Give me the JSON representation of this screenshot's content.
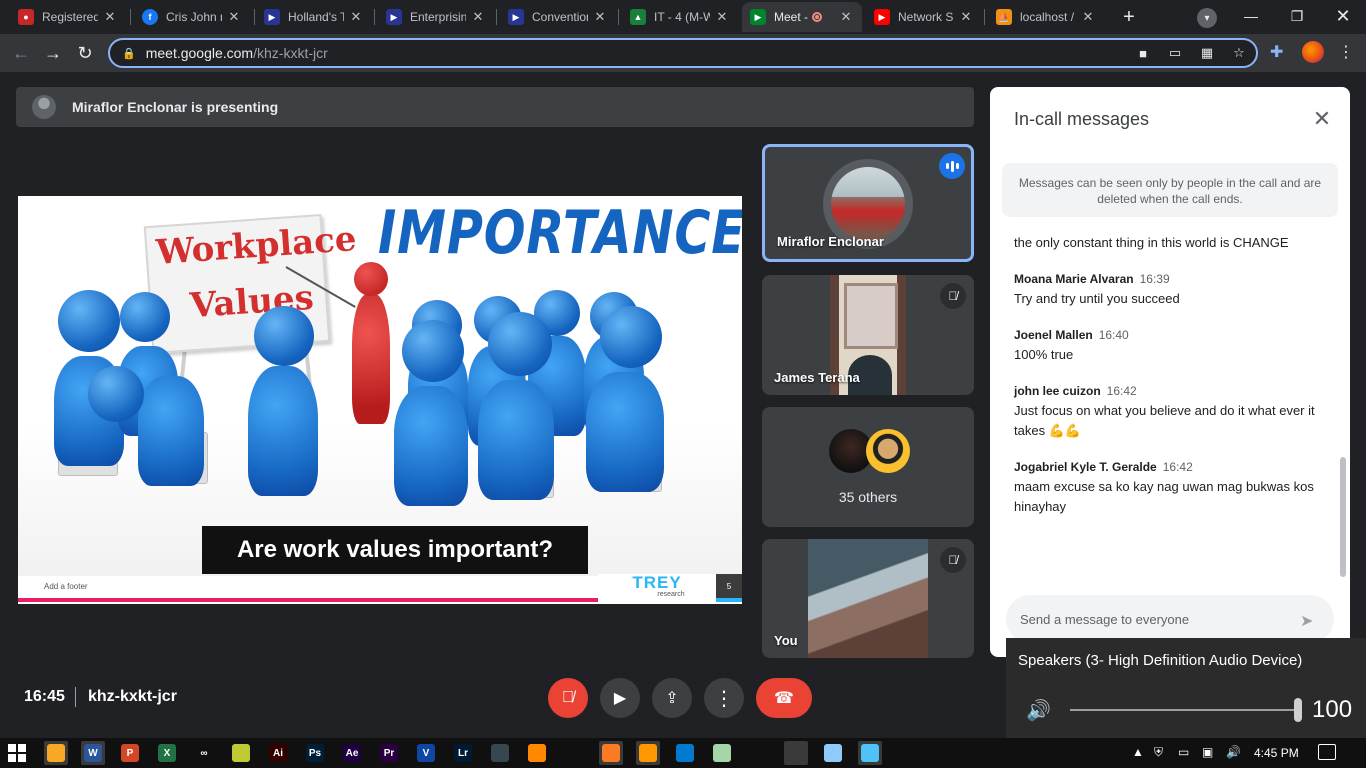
{
  "browser": {
    "tabs": [
      {
        "label": "Registered",
        "icon": "registered-site-icon",
        "color": "#c62828",
        "active": false
      },
      {
        "label": "Cris John n",
        "icon": "facebook-icon",
        "color": "#1877f2",
        "active": false
      },
      {
        "label": "Holland's T",
        "icon": "institution-icon",
        "color": "#283593",
        "active": false
      },
      {
        "label": "Enterprisin",
        "icon": "institution-icon",
        "color": "#283593",
        "active": false
      },
      {
        "label": "Convention",
        "icon": "institution-icon",
        "color": "#283593",
        "active": false
      },
      {
        "label": "IT - 4 (M-W",
        "icon": "google-classroom-icon",
        "color": "#188038",
        "active": false
      },
      {
        "label": "Meet - ",
        "icon": "google-meet-icon",
        "color": "#00832d",
        "active": true
      },
      {
        "label": "Network S",
        "icon": "youtube-icon",
        "color": "#ff0000",
        "active": false
      },
      {
        "label": "localhost /",
        "icon": "phpmyadmin-icon",
        "color": "#f29111",
        "active": false
      }
    ],
    "url_host": "meet.google.com",
    "url_path": "/khz-kxkt-jcr"
  },
  "meet": {
    "presenting_banner": "Miraflor Enclonar is presenting",
    "slide": {
      "title": "IMPORTANCE",
      "board_line1": "Workplace",
      "board_line2": "Values",
      "caption": "Are work values important?",
      "footer": "Add a footer",
      "brand_main": "TREY",
      "brand_sub": "research",
      "slide_number": "5"
    },
    "tiles": [
      {
        "name": "Miraflor Enclonar",
        "speaking": true
      },
      {
        "name": "James Terana",
        "muted": true
      },
      {
        "name": "35 others"
      },
      {
        "name": "You",
        "muted": true
      }
    ],
    "meeting_time": "16:45",
    "meeting_code": "khz-kxkt-jcr"
  },
  "chat": {
    "title": "In-call messages",
    "notice": "Messages can be seen only by people in the call and are deleted when the call ends.",
    "first_text": "the only constant thing in this world is CHANGE",
    "messages": [
      {
        "sender": "Moana Marie Alvaran",
        "time": "16:39",
        "text": "Try and try until you succeed"
      },
      {
        "sender": "Joenel Mallen",
        "time": "16:40",
        "text": "100% true"
      },
      {
        "sender": "john lee cuizon",
        "time": "16:42",
        "text": "Just focus on what you believe and do it what ever it takes 💪💪"
      },
      {
        "sender": "Jogabriel Kyle T. Geralde",
        "time": "16:42",
        "text": "maam excuse sa ko kay nag uwan mag bukwas kos hinayhay"
      }
    ],
    "input_placeholder": "Send a message to everyone"
  },
  "volume": {
    "device": "Speakers (3- High Definition Audio Device)",
    "level": 100,
    "level_label": "100"
  },
  "taskbar": {
    "clock": "4:45 PM",
    "apps": [
      {
        "label": "",
        "icon": "file-explorer-icon",
        "color": "#f9a825"
      },
      {
        "label": "W",
        "icon": "word-icon",
        "color": "#2b579a"
      },
      {
        "label": "P",
        "icon": "powerpoint-icon",
        "color": "#d24726"
      },
      {
        "label": "X",
        "icon": "excel-icon",
        "color": "#217346"
      },
      {
        "label": "∞",
        "icon": "infinity-app-icon",
        "color": "#101010"
      },
      {
        "label": "",
        "icon": "app-icon",
        "color": "#c0ca33"
      },
      {
        "label": "Ai",
        "icon": "illustrator-icon",
        "color": "#330000"
      },
      {
        "label": "Ps",
        "icon": "photoshop-icon",
        "color": "#001e36"
      },
      {
        "label": "Ae",
        "icon": "after-effects-icon",
        "color": "#1f0040"
      },
      {
        "label": "Pr",
        "icon": "premiere-icon",
        "color": "#2a0040"
      },
      {
        "label": "V",
        "icon": "vegas-icon",
        "color": "#0d47a1"
      },
      {
        "label": "Lr",
        "icon": "lightroom-icon",
        "color": "#001a33"
      },
      {
        "label": "",
        "icon": "app-icon",
        "color": "#37474f"
      },
      {
        "label": "",
        "icon": "vlc-icon",
        "color": "#ff8800"
      },
      {
        "label": "",
        "icon": "chrome-icon",
        "color": "#101010"
      },
      {
        "label": "",
        "icon": "xampp-icon",
        "color": "#fb7a24"
      },
      {
        "label": "",
        "icon": "sublime-icon",
        "color": "#ff9800"
      },
      {
        "label": "",
        "icon": "vscode-icon",
        "color": "#007acc"
      },
      {
        "label": "",
        "icon": "android-icon",
        "color": "#a5d6a7"
      },
      {
        "label": "",
        "icon": "record-icon",
        "color": "#101010"
      },
      {
        "label": "",
        "icon": "chrome-icon",
        "color": "#3a3a3a"
      },
      {
        "label": "",
        "icon": "notepad-icon",
        "color": "#90caf9"
      },
      {
        "label": "",
        "icon": "photos-icon",
        "color": "#4fc3f7"
      }
    ]
  }
}
